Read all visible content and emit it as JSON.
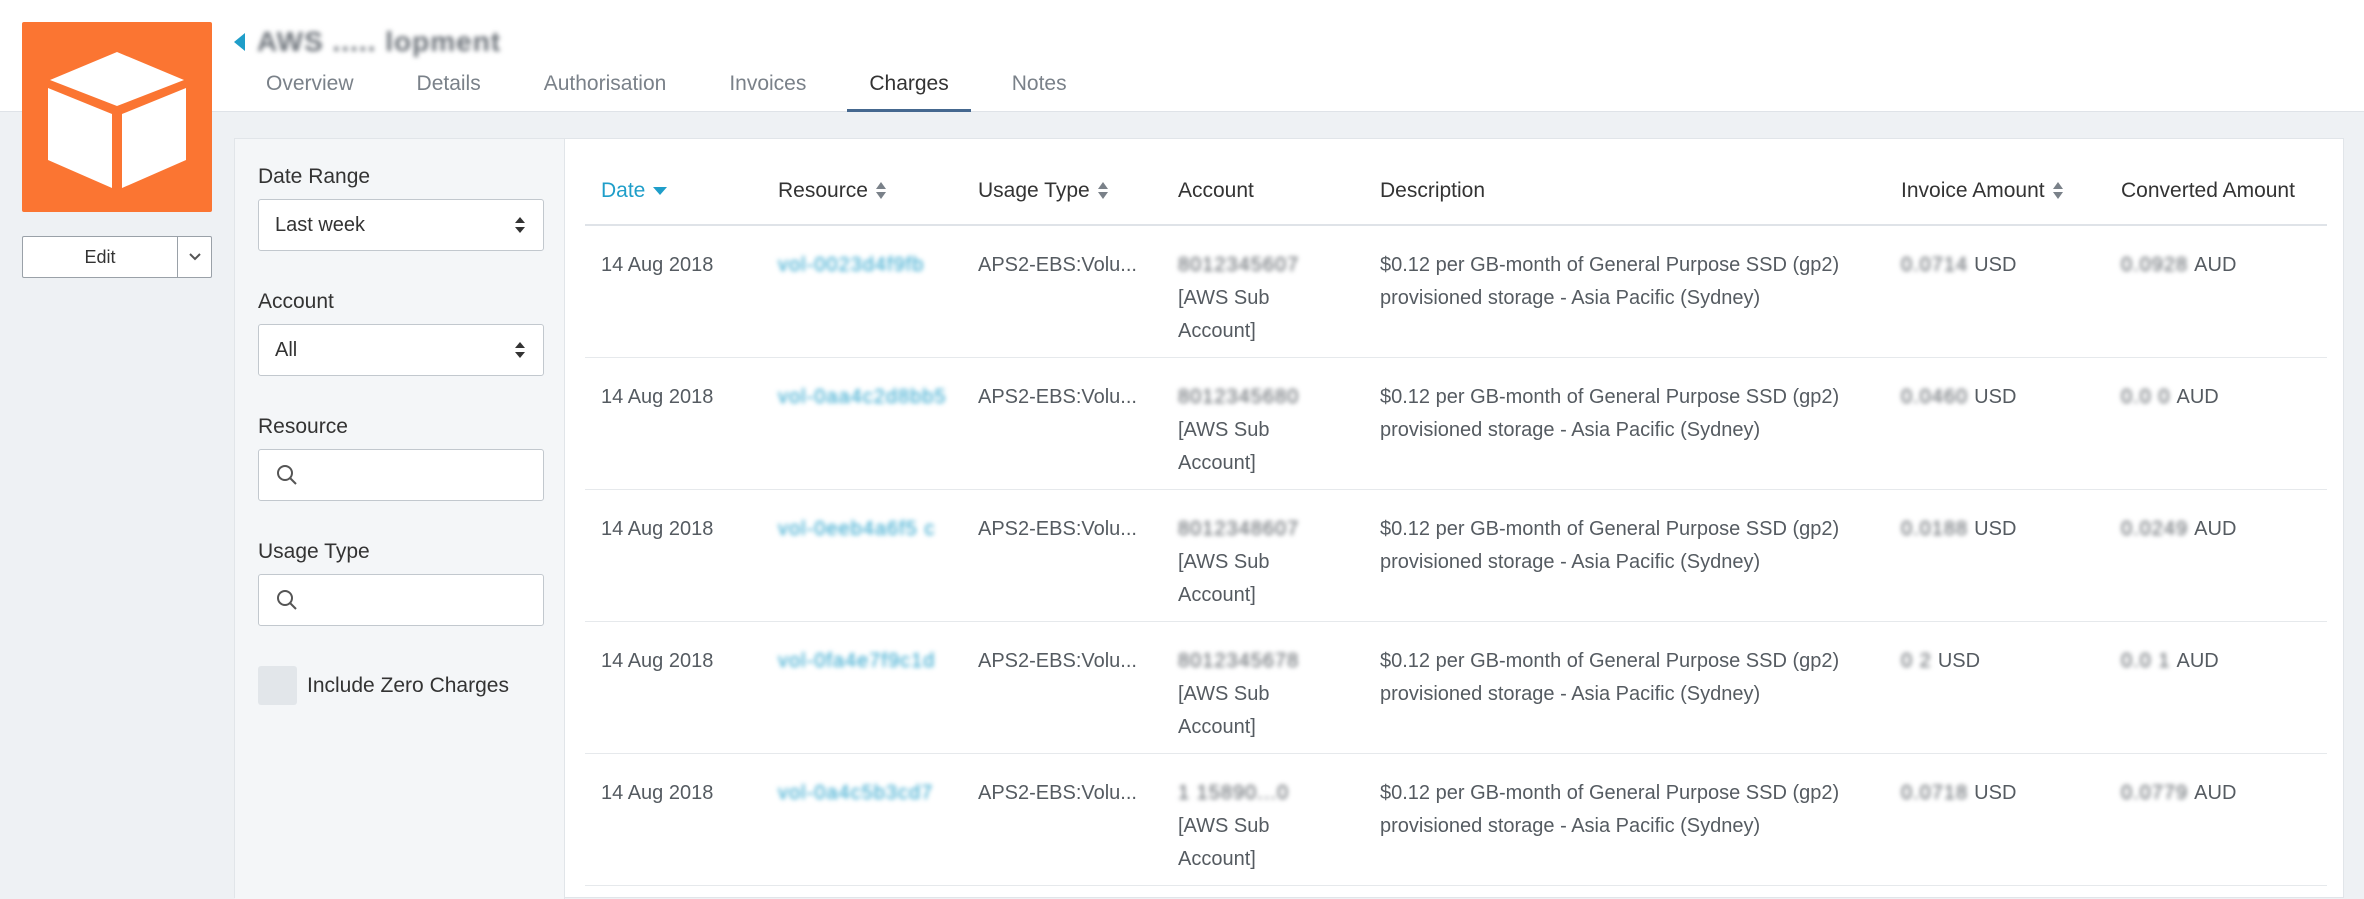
{
  "header": {
    "title": "AWS ..... lopment",
    "tabs": [
      "Overview",
      "Details",
      "Authorisation",
      "Invoices",
      "Charges",
      "Notes"
    ],
    "active_tab": "Charges"
  },
  "logo": {
    "icon": "box-icon",
    "color": "#fb7532"
  },
  "actions": {
    "edit_label": "Edit"
  },
  "filters": {
    "date_range_label": "Date Range",
    "date_range_value": "Last week",
    "account_label": "Account",
    "account_value": "All",
    "resource_label": "Resource",
    "resource_placeholder": "",
    "usage_type_label": "Usage Type",
    "usage_type_placeholder": "",
    "include_zero_label": "Include Zero Charges"
  },
  "table": {
    "columns": {
      "date": "Date",
      "resource": "Resource",
      "usage_type": "Usage Type",
      "account": "Account",
      "description": "Description",
      "invoice_amount": "Invoice Amount",
      "converted_amount": "Converted Amount"
    },
    "rows": [
      {
        "date": "14 Aug 2018",
        "resource": "vol-0023d4f9fb",
        "usage_type": "APS2-EBS:Volu...",
        "account_id": "8012345607",
        "account_sub1": "[AWS Sub",
        "account_sub2": "Account]",
        "desc1": "$0.12 per GB-month of General Purpose SSD (gp2)",
        "desc2": "provisioned storage - Asia Pacific (Sydney)",
        "invoice_value": "0.0714",
        "invoice_currency": "USD",
        "converted_value": "0.0928",
        "converted_currency": "AUD"
      },
      {
        "date": "14 Aug 2018",
        "resource": "vol-0aa4c2d8bb5",
        "usage_type": "APS2-EBS:Volu...",
        "account_id": "8012345680",
        "account_sub1": "[AWS Sub",
        "account_sub2": "Account]",
        "desc1": "$0.12 per GB-month of General Purpose SSD (gp2)",
        "desc2": "provisioned storage - Asia Pacific (Sydney)",
        "invoice_value": "0.0460",
        "invoice_currency": "USD",
        "converted_value": "0.0 0",
        "converted_currency": "AUD"
      },
      {
        "date": "14 Aug 2018",
        "resource": "vol-0eeb4a6f5 c",
        "usage_type": "APS2-EBS:Volu...",
        "account_id": "8012348607",
        "account_sub1": "[AWS Sub",
        "account_sub2": "Account]",
        "desc1": "$0.12 per GB-month of General Purpose SSD (gp2)",
        "desc2": "provisioned storage - Asia Pacific (Sydney)",
        "invoice_value": "0.0188",
        "invoice_currency": "USD",
        "converted_value": "0.0249",
        "converted_currency": "AUD"
      },
      {
        "date": "14 Aug 2018",
        "resource": "vol-0fa4e7f9c1d",
        "usage_type": "APS2-EBS:Volu...",
        "account_id": "8012345678",
        "account_sub1": "[AWS Sub",
        "account_sub2": "Account]",
        "desc1": "$0.12 per GB-month of General Purpose SSD (gp2)",
        "desc2": "provisioned storage - Asia Pacific (Sydney)",
        "invoice_value": "0    2",
        "invoice_currency": "USD",
        "converted_value": "0.0   1",
        "converted_currency": "AUD"
      },
      {
        "date": "14 Aug 2018",
        "resource": "vol-0a4c5b3cd7",
        "usage_type": "APS2-EBS:Volu...",
        "account_id": "1 15890...0",
        "account_sub1": "[AWS Sub",
        "account_sub2": "Account]",
        "desc1": "$0.12 per GB-month of General Purpose SSD (gp2)",
        "desc2": "provisioned storage - Asia Pacific (Sydney)",
        "invoice_value": "0.0718",
        "invoice_currency": "USD",
        "converted_value": "0.0779",
        "converted_currency": "AUD"
      }
    ]
  }
}
